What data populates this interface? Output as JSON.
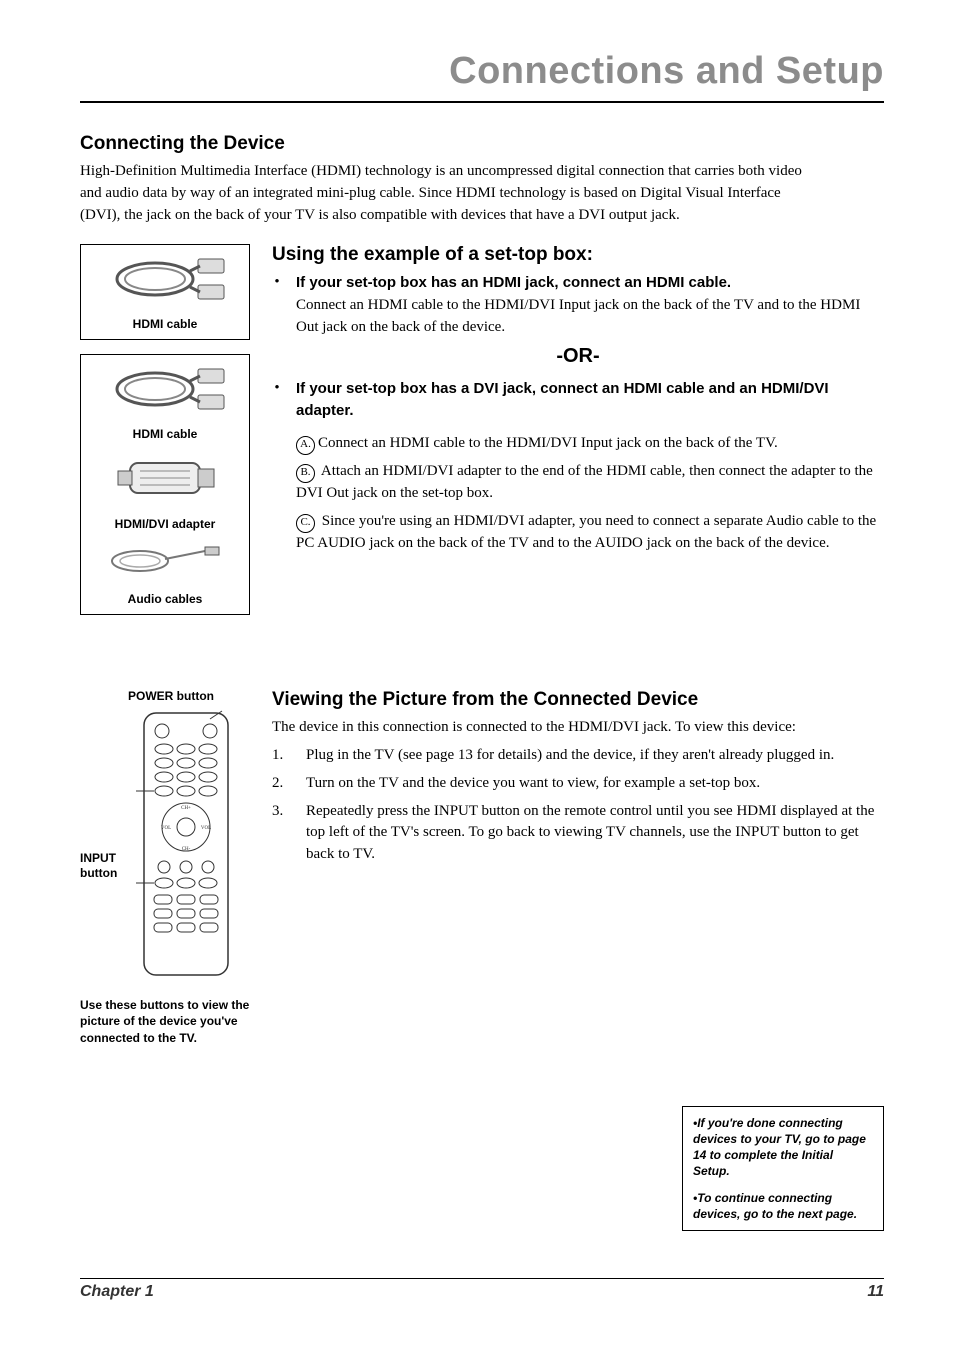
{
  "header": {
    "title": "Connections and Setup"
  },
  "section1": {
    "heading": "Connecting the Device",
    "body": "High-Definition Multimedia Interface (HDMI) technology is an uncompressed digital connection that carries both video and audio data by way of an integrated mini-plug cable. Since HDMI technology is based on Digital Visual Interface (DVI), the jack on the back of your TV is also compatible with devices that have a DVI output jack."
  },
  "side_images": {
    "hdmi_cable_1": "HDMI cable",
    "hdmi_cable_2": "HDMI cable",
    "hdmi_dvi_adapter": "HDMI/DVI adapter",
    "audio_cables": "Audio cables"
  },
  "section2": {
    "heading": "Using the example of a set-top box:",
    "bullet1_bold": "If your set-top box has an HDMI jack, connect an HDMI cable.",
    "bullet1_body": "Connect an HDMI cable to the HDMI/DVI Input jack on the back of the TV and to the HDMI Out jack on the back of the device.",
    "or_sep": "-OR-",
    "bullet2_bold": "If your set-top box has a DVI jack, connect an HDMI cable and an HDMI/DVI adapter.",
    "step_a_label": "A.",
    "step_a": "Connect an HDMI cable to the HDMI/DVI Input jack on the back of the TV.",
    "step_b_label": "B.",
    "step_b": " Attach an HDMI/DVI adapter to the end of the HDMI cable, then connect the adapter to the DVI Out jack on the set-top box.",
    "step_c_label": "C.",
    "step_c": " Since you're using an HDMI/DVI adapter, you need to connect a separate Audio cable to the PC AUDIO jack on the back of the TV and to the AUIDO jack on the back of the device."
  },
  "section3": {
    "heading": "Viewing the Picture from the Connected Device",
    "intro": "The device in this connection is connected to the HDMI/DVI jack. To view this device:",
    "steps": [
      {
        "n": "1.",
        "t": "Plug in the TV (see page 13 for details) and the device, if they aren't already plugged in."
      },
      {
        "n": "2.",
        "t": "Turn on the TV and the device you want to view, for example a set-top box."
      },
      {
        "n": "3.",
        "t": "Repeatedly press the INPUT button on the remote control until you see HDMI displayed at the top left of the TV's screen. To go back to viewing TV channels, use the INPUT button to get back to TV."
      }
    ]
  },
  "remote": {
    "power_label": "POWER button",
    "input_label_1": "INPUT",
    "input_label_2": "button",
    "bottom_caption": "Use these buttons to view the picture of the device you've connected to the TV."
  },
  "tip_box": {
    "line1": "•If you're done connecting devices to your TV, go to page 14 to complete the Initial Setup.",
    "line2": "•To continue connecting devices, go to the next page."
  },
  "footer": {
    "left": "Chapter 1",
    "right": "11"
  }
}
